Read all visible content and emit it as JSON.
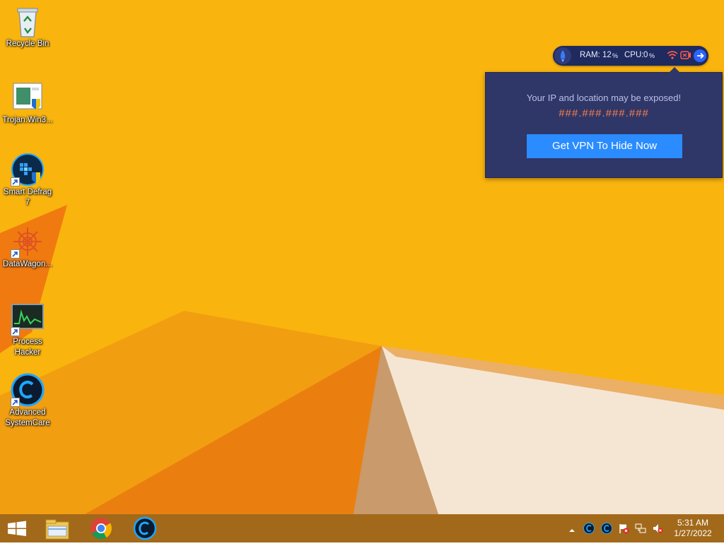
{
  "desktop": {
    "icons": [
      {
        "label": "Recycle Bin",
        "icon": "recycle-bin-icon"
      },
      {
        "label": "Trojan.Win3...",
        "icon": "file-installer-icon"
      },
      {
        "label": "Smart Defrag\n7",
        "icon": "smart-defrag-icon"
      },
      {
        "label": "DataWagon...",
        "icon": "datawagon-icon"
      },
      {
        "label": "Process\nHacker",
        "icon": "process-hacker-icon"
      },
      {
        "label": "Advanced\nSystemCare",
        "icon": "advanced-systemcare-icon"
      }
    ]
  },
  "monitor": {
    "ram_label": "RAM:",
    "ram_value": "12",
    "cpu_label": "CPU:",
    "cpu_value": "0",
    "percent": "%"
  },
  "vpn_popup": {
    "warning": "Your IP and location may be exposed!",
    "ip": "###.###.###.###",
    "button_label": "Get VPN To Hide Now"
  },
  "taskbar": {
    "pinned": [
      "file-explorer-icon",
      "chrome-icon",
      "advanced-systemcare-icon"
    ],
    "tray": [
      "tray-overflow-icon",
      "systemcare-tray-icon",
      "systemcare-tray-icon",
      "action-center-flag-icon",
      "network-icon",
      "volume-muted-icon"
    ],
    "time": "5:31 AM",
    "date": "1/27/2022"
  },
  "colors": {
    "wallpaper": "#f9b40e",
    "taskbar": "#a2691a",
    "popup_bg": "#2f3668",
    "popup_button": "#2a8cff",
    "ip_text": "#ff8048",
    "monitor_bg": "#1f2a5e"
  }
}
